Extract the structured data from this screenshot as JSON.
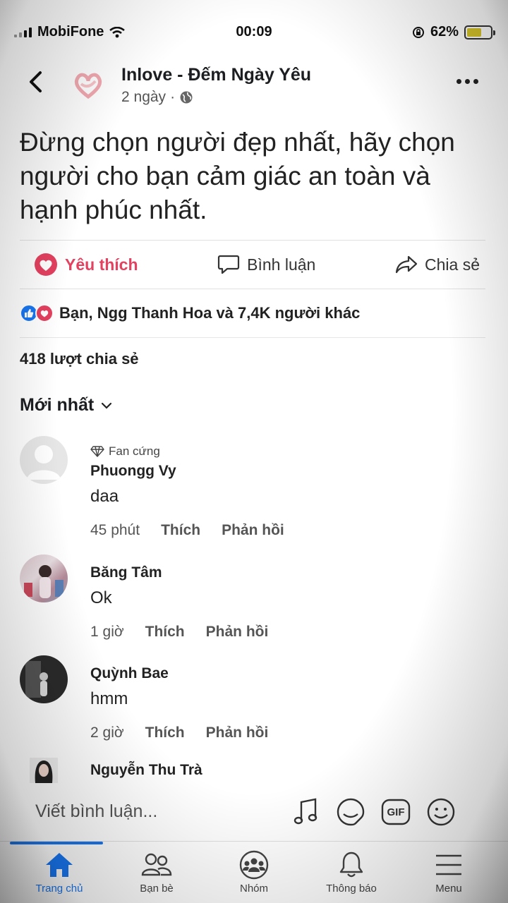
{
  "status": {
    "carrier": "MobiFone",
    "time": "00:09",
    "battery": "62%",
    "battery_level": 0.62
  },
  "header": {
    "page_name": "Inlove - Đếm Ngày Yêu",
    "time_ago": "2 ngày",
    "separator": "·"
  },
  "post": {
    "text": "Đừng chọn người đẹp nhất, hãy chọn người cho bạn cảm giác an toàn và hạnh phúc nhất."
  },
  "actions": {
    "like": "Yêu thích",
    "comment": "Bình luận",
    "share": "Chia sẻ"
  },
  "reactions": {
    "summary": "Bạn, Ngg Thanh Hoa và 7,4K người khác"
  },
  "shares": "418 lượt chia sẻ",
  "sort": {
    "label": "Mới nhất"
  },
  "comments": [
    {
      "badge": "Fan cứng",
      "name": "Phuongg Vy",
      "text": "daa",
      "time": "45 phút",
      "like": "Thích",
      "reply": "Phản hồi"
    },
    {
      "name": "Băng Tâm",
      "text": "Ok",
      "time": "1 giờ",
      "like": "Thích",
      "reply": "Phản hồi"
    },
    {
      "name": "Quỳnh Bae",
      "text": "hmm",
      "time": "2 giờ",
      "like": "Thích",
      "reply": "Phản hồi"
    },
    {
      "name": "Nguyễn Thu Trà"
    }
  ],
  "composer": {
    "placeholder": "Viết bình luận...",
    "gif": "GIF"
  },
  "tabs": [
    {
      "label": "Trang chủ",
      "icon": "home-icon",
      "active": true
    },
    {
      "label": "Bạn bè",
      "icon": "friends-icon"
    },
    {
      "label": "Nhóm",
      "icon": "groups-icon"
    },
    {
      "label": "Thông báo",
      "icon": "bell-icon"
    },
    {
      "label": "Menu",
      "icon": "menu-icon"
    }
  ],
  "colors": {
    "accent": "#1877f2",
    "love": "#e4405f"
  }
}
